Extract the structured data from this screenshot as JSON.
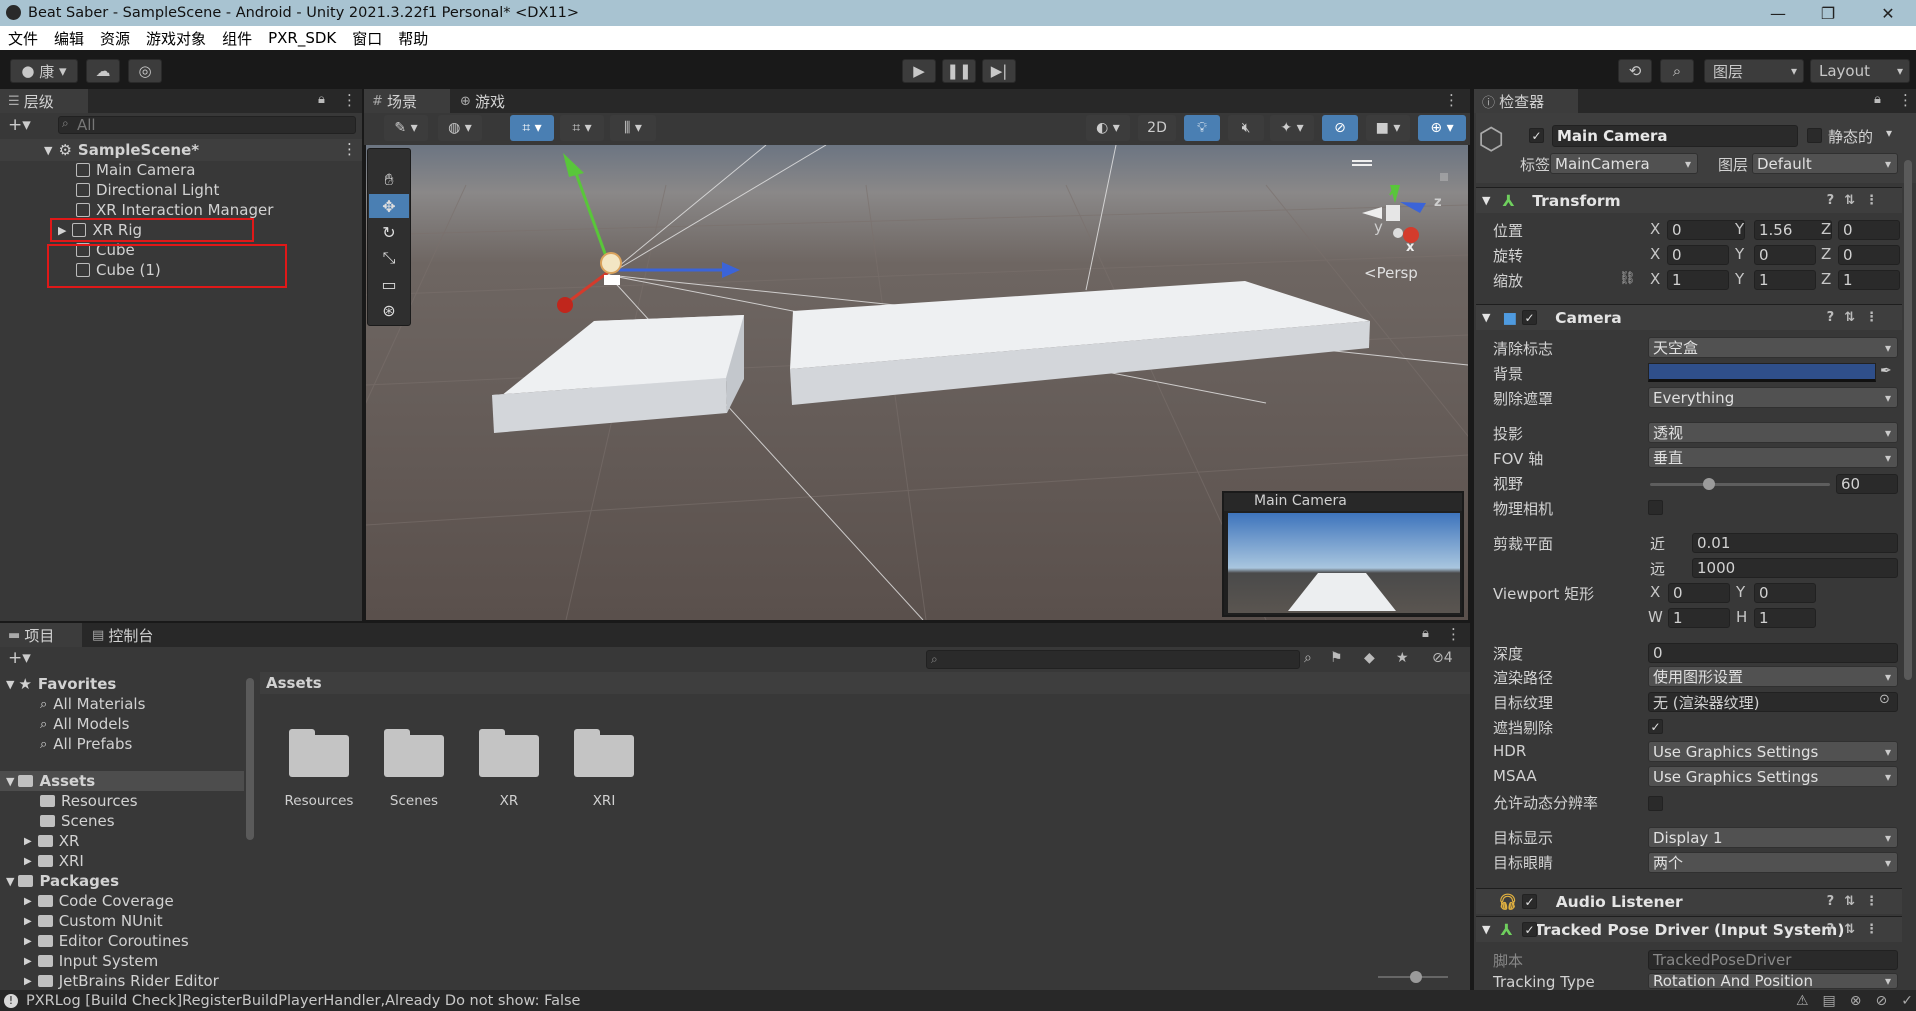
{
  "window": {
    "title": "Beat Saber - SampleScene - Android - Unity 2021.3.22f1 Personal* <DX11>"
  },
  "menu": [
    "文件",
    "编辑",
    "资源",
    "游戏对象",
    "组件",
    "PXR_SDK",
    "窗口",
    "帮助"
  ],
  "toolbar": {
    "account": "康",
    "layers": "图层",
    "layout": "Layout"
  },
  "hierarchy": {
    "tab": "层级",
    "search_placeholder": "All",
    "scene": "SampleScene*",
    "items": [
      "Main Camera",
      "Directional Light",
      "XR Interaction Manager",
      "XR Rig",
      "Cube",
      "Cube (1)"
    ]
  },
  "scene_tabs": {
    "scene": "场景",
    "game": "游戏"
  },
  "scene_view": {
    "mode_2d": "2D",
    "persp": "Persp",
    "preview_title": "Main Camera",
    "gizmo_x": "x",
    "gizmo_y": "y",
    "gizmo_z": "z"
  },
  "inspector": {
    "tab": "检查器",
    "object_name": "Main Camera",
    "static_label": "静态的",
    "tag_label": "标签",
    "tag_value": "MainCamera",
    "layer_label": "图层",
    "layer_value": "Default",
    "transform": {
      "title": "Transform",
      "position_label": "位置",
      "rotation_label": "旋转",
      "scale_label": "缩放",
      "position": [
        "0",
        "1.56",
        "0"
      ],
      "rotation": [
        "0",
        "0",
        "0"
      ],
      "scale": [
        "1",
        "1",
        "1"
      ]
    },
    "camera": {
      "title": "Camera",
      "clear_flags_label": "清除标志",
      "clear_flags": "天空盒",
      "background_label": "背景",
      "culling_mask_label": "剔除遮罩",
      "culling_mask": "Everything",
      "projection_label": "投影",
      "projection": "透视",
      "fov_axis_label": "FOV 轴",
      "fov_axis": "垂直",
      "fov_label": "视野",
      "fov": "60",
      "physical_label": "物理相机",
      "clipping_label": "剪裁平面",
      "near_label": "近",
      "near": "0.01",
      "far_label": "远",
      "far": "1000",
      "viewport_label": "Viewport 矩形",
      "vp_x": "0",
      "vp_y": "0",
      "vp_w": "1",
      "vp_h": "1",
      "depth_label": "深度",
      "depth": "0",
      "render_path_label": "渲染路径",
      "render_path": "使用图形设置",
      "target_texture_label": "目标纹理",
      "target_texture": "无 (渲染器纹理)",
      "occlusion_label": "遮挡剔除",
      "hdr_label": "HDR",
      "hdr": "Use Graphics Settings",
      "msaa_label": "MSAA",
      "msaa": "Use Graphics Settings",
      "dynamic_res_label": "允许动态分辨率",
      "target_display_label": "目标显示",
      "target_display": "Display 1",
      "target_eye_label": "目标眼睛",
      "target_eye": "两个"
    },
    "audio_listener": "Audio Listener",
    "tracked_pose": {
      "title": "Tracked Pose Driver (Input System)",
      "script_label": "脚本",
      "script": "TrackedPoseDriver",
      "tracking_type_label": "Tracking Type",
      "tracking_type": "Rotation And Position"
    }
  },
  "project": {
    "tab": "项目",
    "console_tab": "控制台",
    "badge": "4",
    "favorites": "Favorites",
    "fav_items": [
      "All Materials",
      "All Models",
      "All Prefabs"
    ],
    "assets_root": "Assets",
    "asset_children": [
      "Resources",
      "Scenes",
      "XR",
      "XRI"
    ],
    "packages": "Packages",
    "package_items": [
      "Code Coverage",
      "Custom NUnit",
      "Editor Coroutines",
      "Input System",
      "JetBrains Rider Editor"
    ],
    "breadcrumb": "Assets",
    "folders": [
      "Resources",
      "Scenes",
      "XR",
      "XRI"
    ]
  },
  "status": {
    "message": "PXRLog [Build Check]RegisterBuildPlayerHandler,Already Do not show: False"
  }
}
